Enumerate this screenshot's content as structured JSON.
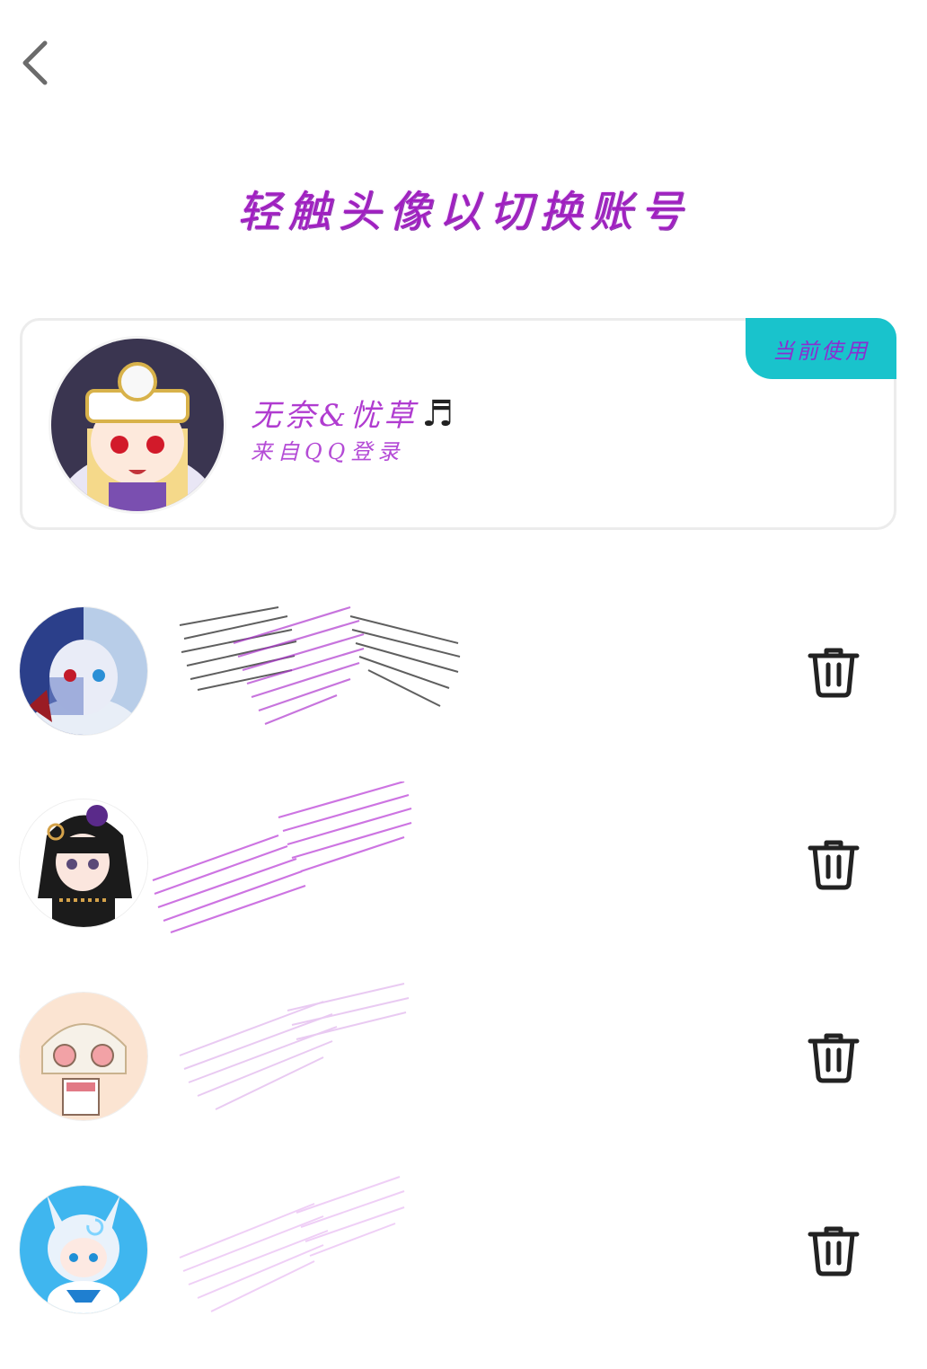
{
  "header": {
    "back_icon": "chevron-left-icon",
    "title": "轻触头像以切换账号"
  },
  "current_account": {
    "badge": "当前使用",
    "name": "无奈&忧草",
    "name_suffix": "♬",
    "source": "来自QQ登录"
  },
  "accounts": [
    {
      "name": "",
      "delete_icon": "trash-icon"
    },
    {
      "name": "",
      "delete_icon": "trash-icon"
    },
    {
      "name": "",
      "delete_icon": "trash-icon"
    },
    {
      "name": "",
      "delete_icon": "trash-icon"
    }
  ],
  "colors": {
    "accent_purple": "#a020c0",
    "badge_teal": "#19c3cc",
    "icon_dark": "#222222"
  }
}
